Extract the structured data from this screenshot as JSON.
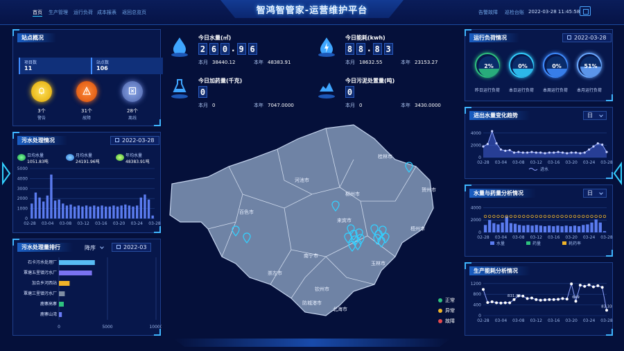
{
  "header": {
    "title": "智鸿智管家-运营维护平台",
    "nav_left": [
      "首页",
      "生产管理",
      "运行负荷",
      "成本报表",
      "返回总览页"
    ],
    "nav_right": [
      "告警故障",
      "巡检台账"
    ],
    "datetime": "2022-03-28 11:45:58"
  },
  "station_overview": {
    "title": "站点概况",
    "project_label": "项目数",
    "project_value": "11",
    "station_label": "站点数",
    "station_value": "106",
    "alarm_count": "3个",
    "alarm_label": "警告",
    "fault_count": "31个",
    "fault_label": "故障",
    "offline_count": "28个",
    "offline_label": "离线"
  },
  "sewage": {
    "title": "污水处理情况",
    "date": "2022-03-28",
    "daily_label": "日均水量",
    "daily_value": "1051.83吨",
    "monthly_label": "月均水量",
    "monthly_value": "24191.96吨",
    "yearly_label": "年均水量",
    "yearly_value": "48383.91吨"
  },
  "sewage_chart": {
    "type": "bar",
    "y_ticks": [
      "5000",
      "4000",
      "3000",
      "2000",
      "1000",
      "0"
    ],
    "ylim": [
      0,
      5000
    ],
    "x_ticks": [
      "02-28",
      "03-04",
      "03-08",
      "03-12",
      "03-16",
      "03-20",
      "03-24",
      "03-28"
    ],
    "values": [
      1500,
      2600,
      2100,
      1700,
      2300,
      4400,
      1800,
      1900,
      1500,
      1300,
      1400,
      1200,
      1300,
      1200,
      1300,
      1200,
      1300,
      1200,
      1300,
      1200,
      1200,
      1300,
      1200,
      1300,
      1400,
      1300,
      1200,
      1300,
      2100,
      2400,
      1900,
      300
    ]
  },
  "ranking": {
    "title": "污水处理量排行",
    "sort": "降序",
    "date": "2022-03",
    "type": "bar",
    "orientation": "horizontal",
    "categories": [
      "石卡污水处理厂",
      "覃塘五里镇污水厂",
      "加合乡河西站",
      "覃塘三里镇污水厂",
      "鹿寨高寨",
      "鹿寨山湾"
    ],
    "values": [
      3700,
      3400,
      1100,
      600,
      500,
      300
    ],
    "colors": [
      "#58bdf5",
      "#7a73f0",
      "#f0b429",
      "#7f8ea3",
      "#2ec27e",
      "#6a7cf7"
    ],
    "x_ticks": [
      "0",
      "5000",
      "10000"
    ],
    "xlim": [
      0,
      10000
    ]
  },
  "top_stats": {
    "water": {
      "title": "今日水量(㎡)",
      "digits": [
        "2",
        "6",
        "0",
        "9",
        "6"
      ],
      "decimals": 2,
      "month_label": "本月",
      "month_value": "38440.12",
      "year_label": "本年",
      "year_value": "48383.91"
    },
    "energy": {
      "title": "今日能耗(kwh)",
      "digits": [
        "8",
        "8",
        "8",
        "3"
      ],
      "decimals": 2,
      "month_label": "本月",
      "month_value": "18632.55",
      "year_label": "本年",
      "year_value": "23153.27"
    },
    "dosing": {
      "title": "今日加药量(千克)",
      "digits": [
        "0"
      ],
      "decimals": 0,
      "month_label": "本月",
      "month_value": "0",
      "year_label": "本年",
      "year_value": "7047.0000"
    },
    "sludge": {
      "title": "今日污泥处置量(吨)",
      "digits": [
        "0"
      ],
      "decimals": 0,
      "month_label": "本月",
      "month_value": "0",
      "year_label": "本年",
      "year_value": "3430.0000"
    }
  },
  "map": {
    "cities": [
      "桂林市",
      "河池市",
      "柳州市",
      "贺州市",
      "百色市",
      "来宾市",
      "梧州市",
      "南宁市",
      "玉林市",
      "崇左市",
      "钦州市",
      "防城港市",
      "北海市"
    ],
    "legend": [
      {
        "label": "正常",
        "color": "#2ec27e"
      },
      {
        "label": "异常",
        "color": "#f0b429"
      },
      {
        "label": "故障",
        "color": "#e5484d"
      }
    ]
  },
  "load": {
    "title": "运行负荷情况",
    "date": "2022-03-28",
    "gauges": [
      {
        "value": 2,
        "pct": "2%",
        "label": "昨日运行负荷",
        "color": "#2ec27e"
      },
      {
        "value": 0,
        "pct": "0%",
        "label": "本日运行负荷",
        "color": "#33d0ff"
      },
      {
        "value": 0,
        "pct": "0%",
        "label": "本周运行负荷",
        "color": "#3f8cff"
      },
      {
        "value": 51,
        "pct": "51%",
        "label": "本月运行负荷",
        "color": "#6aa8ff"
      }
    ]
  },
  "inflow": {
    "title": "进出水量变化趋势",
    "select": "日",
    "type": "area",
    "y_ticks": [
      "4000",
      "2000",
      "0"
    ],
    "ylim": [
      0,
      5000
    ],
    "x_ticks": [
      "02-28",
      "03-04",
      "03-08",
      "03-12",
      "03-16",
      "03-20",
      "03-24",
      "03-28"
    ],
    "legend": "进水",
    "values": [
      1800,
      2200,
      4300,
      2300,
      1300,
      1100,
      1200,
      800,
      900,
      800,
      800,
      900,
      800,
      800,
      700,
      800,
      800,
      900,
      800,
      700,
      800,
      800,
      700,
      800,
      1300,
      1800,
      2300,
      2100,
      900
    ]
  },
  "dosing_analysis": {
    "title": "水量与药量分析情况",
    "select": "日",
    "type": "bar",
    "y_ticks": [
      "4000",
      "2000",
      "0"
    ],
    "ylim": [
      0,
      4500
    ],
    "x_ticks": [
      "02-28",
      "03-04",
      "03-08",
      "03-12",
      "03-16",
      "03-20",
      "03-24",
      "03-28"
    ],
    "legend": [
      "水量",
      "药量",
      "耗药率"
    ],
    "water": [
      1200,
      2000,
      1500,
      1300,
      1600,
      2600,
      1500,
      1400,
      1200,
      1100,
      1200,
      1100,
      1200,
      1100,
      1000,
      1100,
      1000,
      1100,
      1000,
      1100,
      1000,
      1100,
      1000,
      1200,
      1300,
      1600,
      2100,
      1600,
      200
    ],
    "ratio_line": 2600
  },
  "energy_analysis": {
    "title": "生产能耗分析情况",
    "type": "line",
    "y_ticks": [
      "1200",
      "800",
      "400",
      "0"
    ],
    "ylim": [
      0,
      1300
    ],
    "x_ticks": [
      "02-28",
      "03-04",
      "03-08",
      "03-12",
      "03-16",
      "03-20",
      "03-24",
      "03-28"
    ],
    "values": [
      980,
      490,
      520,
      480,
      470,
      480,
      480,
      600,
      740,
      730,
      640,
      660,
      600,
      580,
      590,
      600,
      600,
      610,
      640,
      620,
      1190,
      540,
      1140,
      1100,
      1150,
      1080,
      1120,
      1060,
      200
    ],
    "labels": [
      {
        "i": 7,
        "text": "831.04"
      },
      {
        "i": 21,
        "text": "649"
      },
      {
        "i": 28,
        "text": "83.33"
      }
    ]
  }
}
